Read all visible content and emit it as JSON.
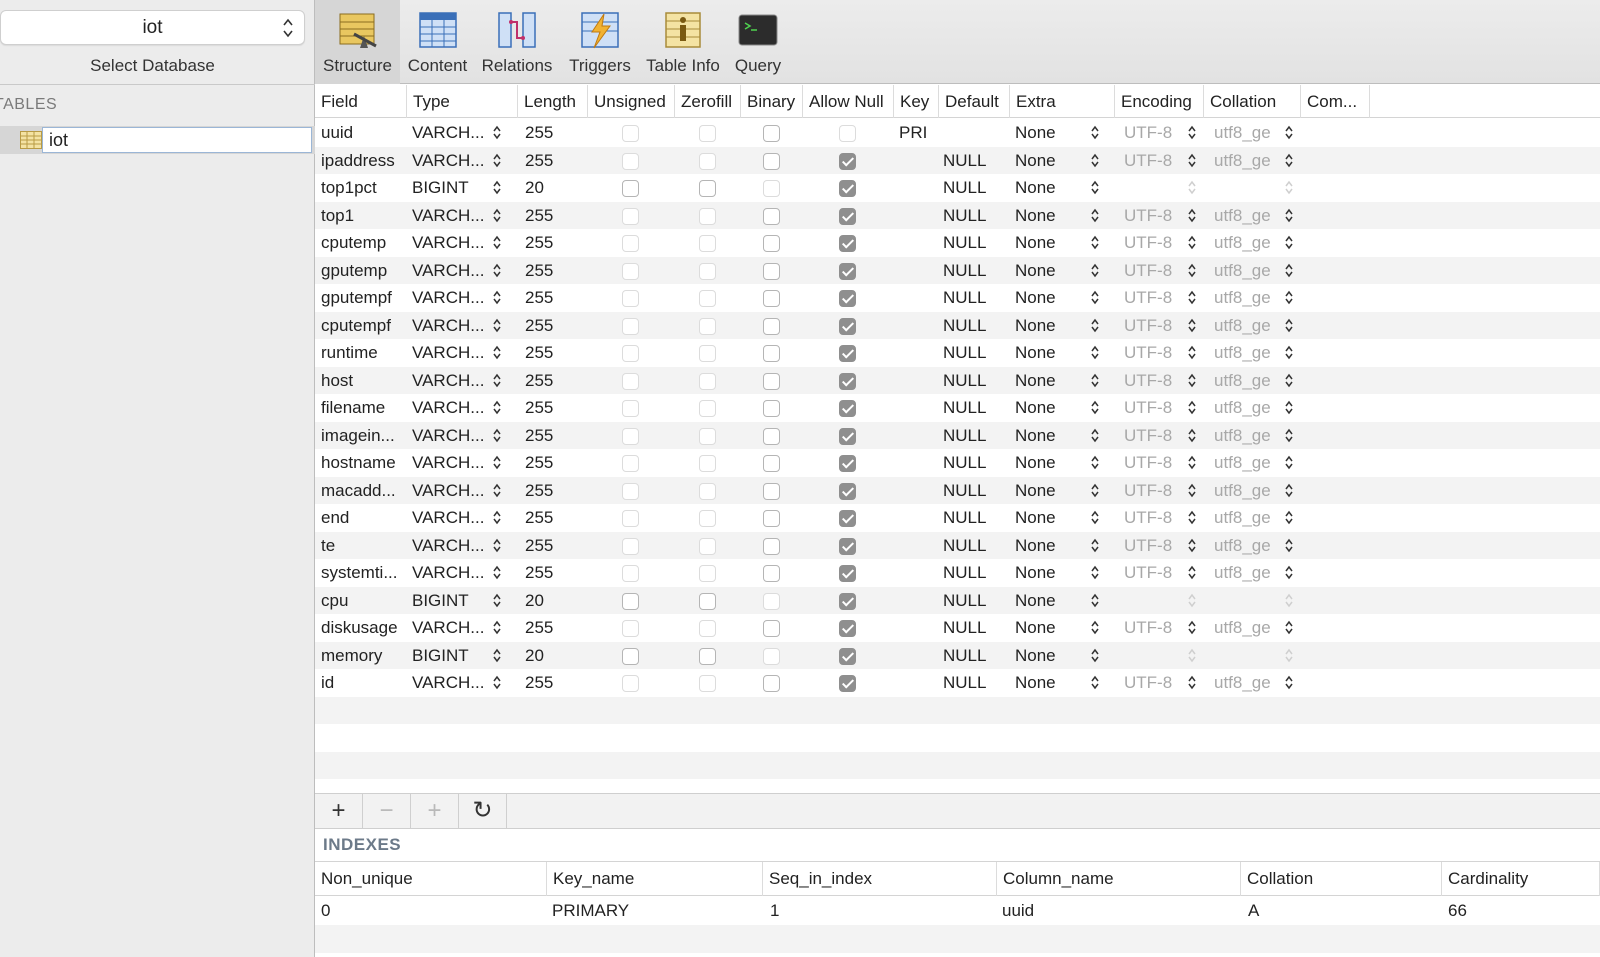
{
  "sidebar": {
    "database_value": "iot",
    "select_database_label": "Select Database",
    "tables_header": "TABLES",
    "table_name": "iot"
  },
  "toolbar": {
    "items": [
      {
        "label": "Structure",
        "icon": "structure-icon",
        "active": true
      },
      {
        "label": "Content",
        "icon": "content-icon"
      },
      {
        "label": "Relations",
        "icon": "relations-icon"
      },
      {
        "label": "Triggers",
        "icon": "triggers-icon"
      },
      {
        "label": "Table Info",
        "icon": "table-info-icon"
      },
      {
        "label": "Query",
        "icon": "query-icon"
      }
    ]
  },
  "structure": {
    "columns": [
      "Field",
      "Type",
      "Length",
      "Unsigned",
      "Zerofill",
      "Binary",
      "Allow Null",
      "Key",
      "Default",
      "Extra",
      "Encoding",
      "Collation",
      "Com..."
    ],
    "rows": [
      {
        "field": "uuid",
        "type": "VARCH...",
        "length": "255",
        "unsigned": false,
        "zerofill": false,
        "binary": false,
        "allow_null": false,
        "key": "PRI",
        "default": "",
        "extra": "None",
        "encoding": "UTF-8",
        "collation": "utf8_ge"
      },
      {
        "field": "ipaddress",
        "type": "VARCH...",
        "length": "255",
        "unsigned": false,
        "zerofill": false,
        "binary": false,
        "allow_null": true,
        "key": "",
        "default": "NULL",
        "extra": "None",
        "encoding": "UTF-8",
        "collation": "utf8_ge"
      },
      {
        "field": "top1pct",
        "type": "BIGINT",
        "length": "20",
        "unsigned": false,
        "zerofill": false,
        "binary": false,
        "allow_null": true,
        "key": "",
        "default": "NULL",
        "extra": "None",
        "encoding": "",
        "collation": ""
      },
      {
        "field": "top1",
        "type": "VARCH...",
        "length": "255",
        "unsigned": false,
        "zerofill": false,
        "binary": false,
        "allow_null": true,
        "key": "",
        "default": "NULL",
        "extra": "None",
        "encoding": "UTF-8",
        "collation": "utf8_ge"
      },
      {
        "field": "cputemp",
        "type": "VARCH...",
        "length": "255",
        "unsigned": false,
        "zerofill": false,
        "binary": false,
        "allow_null": true,
        "key": "",
        "default": "NULL",
        "extra": "None",
        "encoding": "UTF-8",
        "collation": "utf8_ge"
      },
      {
        "field": "gputemp",
        "type": "VARCH...",
        "length": "255",
        "unsigned": false,
        "zerofill": false,
        "binary": false,
        "allow_null": true,
        "key": "",
        "default": "NULL",
        "extra": "None",
        "encoding": "UTF-8",
        "collation": "utf8_ge"
      },
      {
        "field": "gputempf",
        "type": "VARCH...",
        "length": "255",
        "unsigned": false,
        "zerofill": false,
        "binary": false,
        "allow_null": true,
        "key": "",
        "default": "NULL",
        "extra": "None",
        "encoding": "UTF-8",
        "collation": "utf8_ge"
      },
      {
        "field": "cputempf",
        "type": "VARCH...",
        "length": "255",
        "unsigned": false,
        "zerofill": false,
        "binary": false,
        "allow_null": true,
        "key": "",
        "default": "NULL",
        "extra": "None",
        "encoding": "UTF-8",
        "collation": "utf8_ge"
      },
      {
        "field": "runtime",
        "type": "VARCH...",
        "length": "255",
        "unsigned": false,
        "zerofill": false,
        "binary": false,
        "allow_null": true,
        "key": "",
        "default": "NULL",
        "extra": "None",
        "encoding": "UTF-8",
        "collation": "utf8_ge"
      },
      {
        "field": "host",
        "type": "VARCH...",
        "length": "255",
        "unsigned": false,
        "zerofill": false,
        "binary": false,
        "allow_null": true,
        "key": "",
        "default": "NULL",
        "extra": "None",
        "encoding": "UTF-8",
        "collation": "utf8_ge"
      },
      {
        "field": "filename",
        "type": "VARCH...",
        "length": "255",
        "unsigned": false,
        "zerofill": false,
        "binary": false,
        "allow_null": true,
        "key": "",
        "default": "NULL",
        "extra": "None",
        "encoding": "UTF-8",
        "collation": "utf8_ge"
      },
      {
        "field": "imagein...",
        "type": "VARCH...",
        "length": "255",
        "unsigned": false,
        "zerofill": false,
        "binary": false,
        "allow_null": true,
        "key": "",
        "default": "NULL",
        "extra": "None",
        "encoding": "UTF-8",
        "collation": "utf8_ge"
      },
      {
        "field": "hostname",
        "type": "VARCH...",
        "length": "255",
        "unsigned": false,
        "zerofill": false,
        "binary": false,
        "allow_null": true,
        "key": "",
        "default": "NULL",
        "extra": "None",
        "encoding": "UTF-8",
        "collation": "utf8_ge"
      },
      {
        "field": "macadd...",
        "type": "VARCH...",
        "length": "255",
        "unsigned": false,
        "zerofill": false,
        "binary": false,
        "allow_null": true,
        "key": "",
        "default": "NULL",
        "extra": "None",
        "encoding": "UTF-8",
        "collation": "utf8_ge"
      },
      {
        "field": "end",
        "type": "VARCH...",
        "length": "255",
        "unsigned": false,
        "zerofill": false,
        "binary": false,
        "allow_null": true,
        "key": "",
        "default": "NULL",
        "extra": "None",
        "encoding": "UTF-8",
        "collation": "utf8_ge"
      },
      {
        "field": "te",
        "type": "VARCH...",
        "length": "255",
        "unsigned": false,
        "zerofill": false,
        "binary": false,
        "allow_null": true,
        "key": "",
        "default": "NULL",
        "extra": "None",
        "encoding": "UTF-8",
        "collation": "utf8_ge"
      },
      {
        "field": "systemti...",
        "type": "VARCH...",
        "length": "255",
        "unsigned": false,
        "zerofill": false,
        "binary": false,
        "allow_null": true,
        "key": "",
        "default": "NULL",
        "extra": "None",
        "encoding": "UTF-8",
        "collation": "utf8_ge"
      },
      {
        "field": "cpu",
        "type": "BIGINT",
        "length": "20",
        "unsigned": false,
        "zerofill": false,
        "binary": false,
        "allow_null": true,
        "key": "",
        "default": "NULL",
        "extra": "None",
        "encoding": "",
        "collation": ""
      },
      {
        "field": "diskusage",
        "type": "VARCH...",
        "length": "255",
        "unsigned": false,
        "zerofill": false,
        "binary": false,
        "allow_null": true,
        "key": "",
        "default": "NULL",
        "extra": "None",
        "encoding": "UTF-8",
        "collation": "utf8_ge"
      },
      {
        "field": "memory",
        "type": "BIGINT",
        "length": "20",
        "unsigned": false,
        "zerofill": false,
        "binary": false,
        "allow_null": true,
        "key": "",
        "default": "NULL",
        "extra": "None",
        "encoding": "",
        "collation": ""
      },
      {
        "field": "id",
        "type": "VARCH...",
        "length": "255",
        "unsigned": false,
        "zerofill": false,
        "binary": false,
        "allow_null": true,
        "key": "",
        "default": "NULL",
        "extra": "None",
        "encoding": "UTF-8",
        "collation": "utf8_ge"
      }
    ]
  },
  "buttons": {
    "add": "+",
    "remove": "−",
    "duplicate": "+",
    "refresh": "↻"
  },
  "indexes": {
    "label": "INDEXES",
    "columns": [
      "Non_unique",
      "Key_name",
      "Seq_in_index",
      "Column_name",
      "Collation",
      "Cardinality"
    ],
    "rows": [
      [
        "0",
        "PRIMARY",
        "1",
        "uuid",
        "A",
        "66"
      ]
    ]
  }
}
